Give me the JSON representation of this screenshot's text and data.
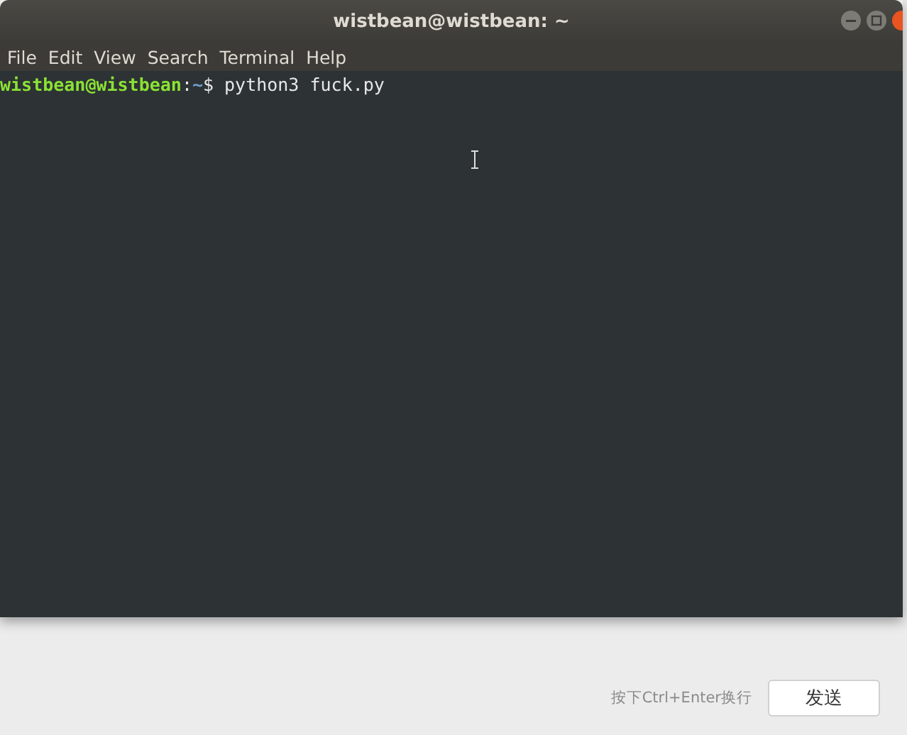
{
  "window": {
    "title": "wistbean@wistbean: ~"
  },
  "menu": [
    "File",
    "Edit",
    "View",
    "Search",
    "Terminal",
    "Help"
  ],
  "terminal": {
    "user_host": "wistbean@wistbean",
    "separator": ":",
    "path": "~",
    "prompt": "$",
    "command": "python3 fuck.py"
  },
  "footer": {
    "hint": "按下Ctrl+Enter换行",
    "send_button": "发送"
  }
}
